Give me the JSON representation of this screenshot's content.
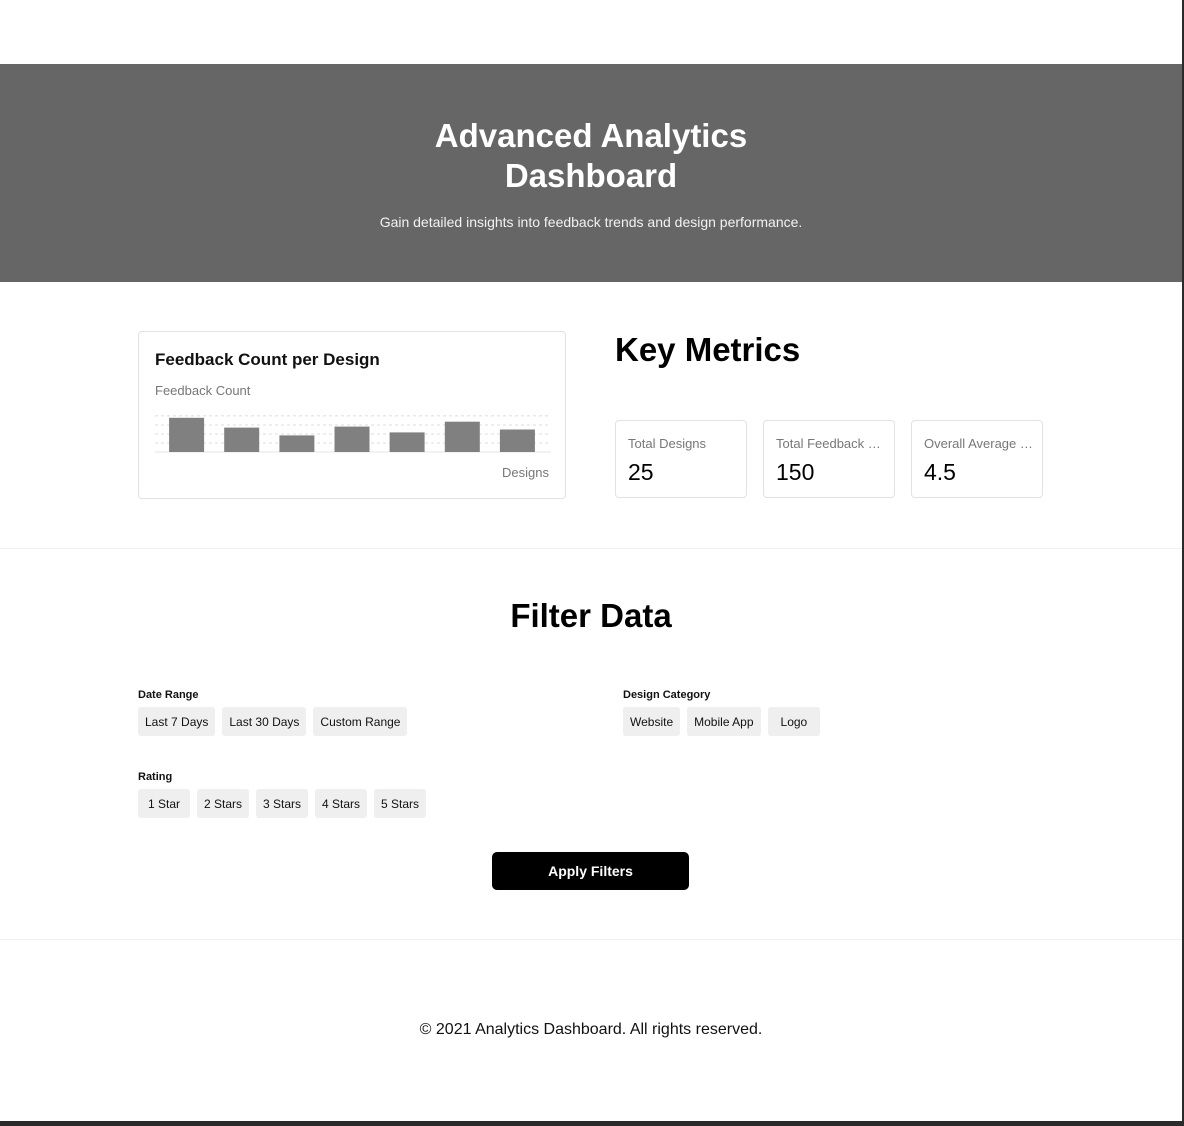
{
  "hero": {
    "title": "Advanced Analytics Dashboard",
    "subtitle": "Gain detailed insights into feedback trends and design performance."
  },
  "chart_data": {
    "type": "bar",
    "title": "Feedback Count per Design",
    "ylabel": "Feedback Count",
    "xlabel": "Designs",
    "bar_color": "#808080",
    "grid": true,
    "values": [
      35,
      25,
      17,
      26,
      20,
      31,
      23
    ],
    "ylim": [
      0,
      45
    ]
  },
  "metrics": {
    "heading": "Key Metrics",
    "cards": [
      {
        "label": "Total Designs",
        "value": "25"
      },
      {
        "label": "Total Feedback Received",
        "value": "150"
      },
      {
        "label": "Overall Average Rating",
        "value": "4.5"
      }
    ]
  },
  "filters": {
    "heading": "Filter Data",
    "date_range": {
      "label": "Date Range",
      "options": [
        "Last 7 Days",
        "Last 30 Days",
        "Custom Range"
      ]
    },
    "design_category": {
      "label": "Design Category",
      "options": [
        "Website",
        "Mobile App",
        "Logo"
      ]
    },
    "rating": {
      "label": "Rating",
      "options": [
        "1 Star",
        "2 Stars",
        "3 Stars",
        "4 Stars",
        "5 Stars"
      ]
    },
    "apply_label": "Apply Filters"
  },
  "footer": {
    "text": "© 2021 Analytics Dashboard. All rights reserved."
  },
  "colors": {
    "hero_bg": "#666666",
    "button_bg": "#000000",
    "chip_bg": "#efefef"
  }
}
